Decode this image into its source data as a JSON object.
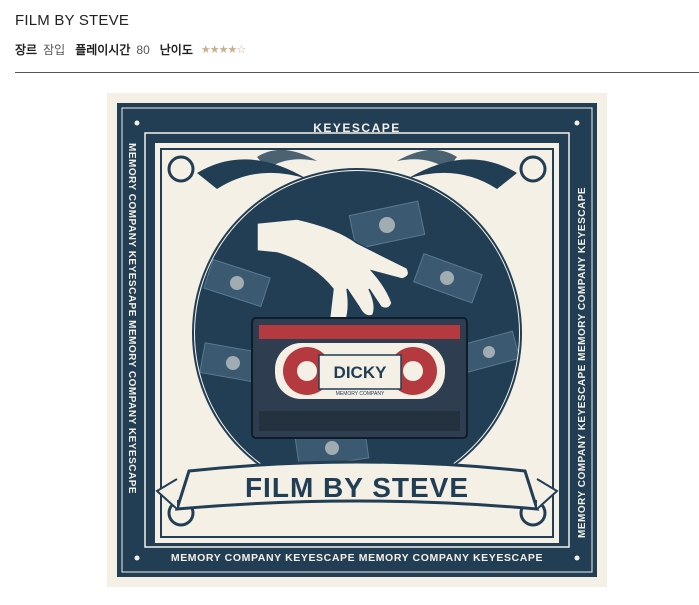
{
  "game": {
    "title": "FILM BY STEVE",
    "genre_label": "장르",
    "genre_value": "잠입",
    "playtime_label": "플레이시간",
    "playtime_value": "80",
    "difficulty_label": "난이도",
    "difficulty_rating": 3.5,
    "difficulty_max": 5,
    "difficulty_stars": "★★★★☆"
  },
  "poster": {
    "brand_top": "KEYESCAPE",
    "side_text": "MEMORY COMPANY KEYESCAPE MEMORY COMPANY KEYESCAPE",
    "bottom_text": "MEMORY COMPANY KEYESCAPE MEMORY COMPANY KEYESCAPE",
    "tape_label": "DICKY",
    "tape_sublabel": "MEMORY COMPANY",
    "banner_text": "FILM BY STEVE",
    "colors": {
      "navy": "#213e55",
      "cream": "#f4f0e6",
      "red": "#b53a3f",
      "mid": "#3b5a72"
    }
  }
}
